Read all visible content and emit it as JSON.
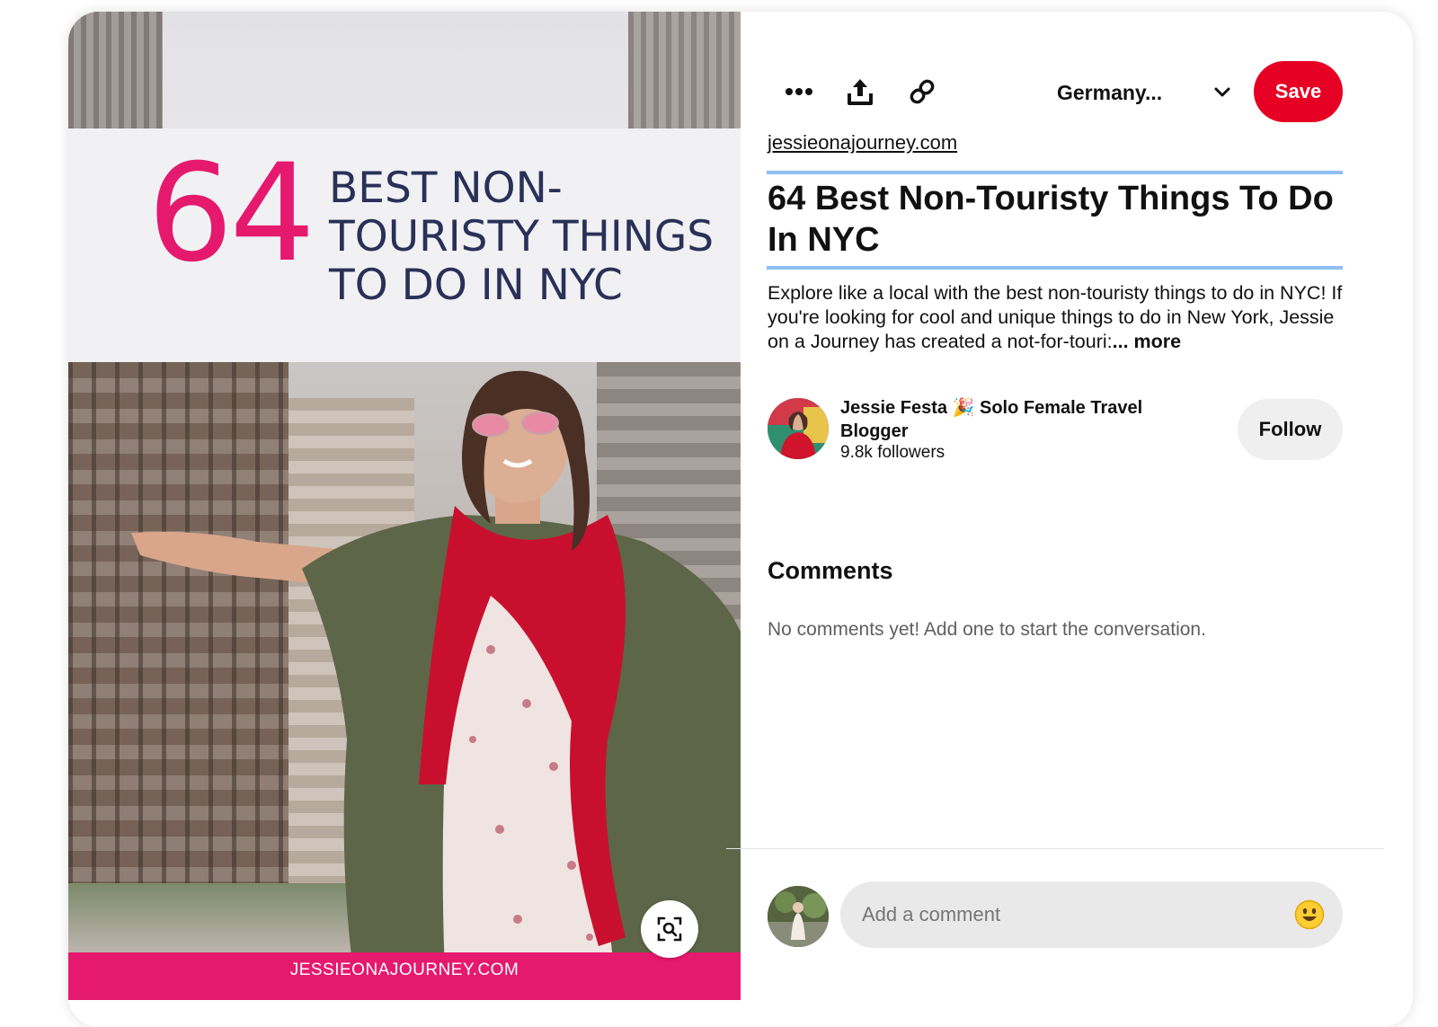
{
  "pin_image": {
    "number": "64",
    "headline_lines": [
      "BEST NON-",
      "TOURISTY THINGS",
      "TO DO IN NYC"
    ],
    "footer_text": "JESSIEONAJOURNEY.COM",
    "lens_icon": "visual-search-icon"
  },
  "toolbar": {
    "more_icon": "ellipsis-icon",
    "share_icon": "share-upload-icon",
    "link_icon": "link-icon",
    "board_label": "Germany...",
    "board_icon": "chevron-down-icon",
    "save_label": "Save"
  },
  "pin": {
    "source": "jessieonajourney.com",
    "title": "64 Best Non-Touristy Things To Do In NYC",
    "description": "Explore like a local with the best non-touristy things to do in NYC! If you're looking for cool and unique things to do in New York, Jessie on a Journey has created a not-for-touri:",
    "more_label": "... more"
  },
  "creator": {
    "name": "Jessie Festa 🎉 Solo Female Travel Blogger",
    "followers": "9.8k followers",
    "follow_label": "Follow"
  },
  "comments": {
    "heading": "Comments",
    "empty_text": "No comments yet! Add one to start the conversation.",
    "input_placeholder": "Add a comment",
    "emoji_icon": "smiley-emoji-icon"
  },
  "colors": {
    "save_red": "#e60023",
    "brand_pink": "#e5196e",
    "headline_navy": "#2a3158",
    "focus_blue": "#8fbef5"
  }
}
